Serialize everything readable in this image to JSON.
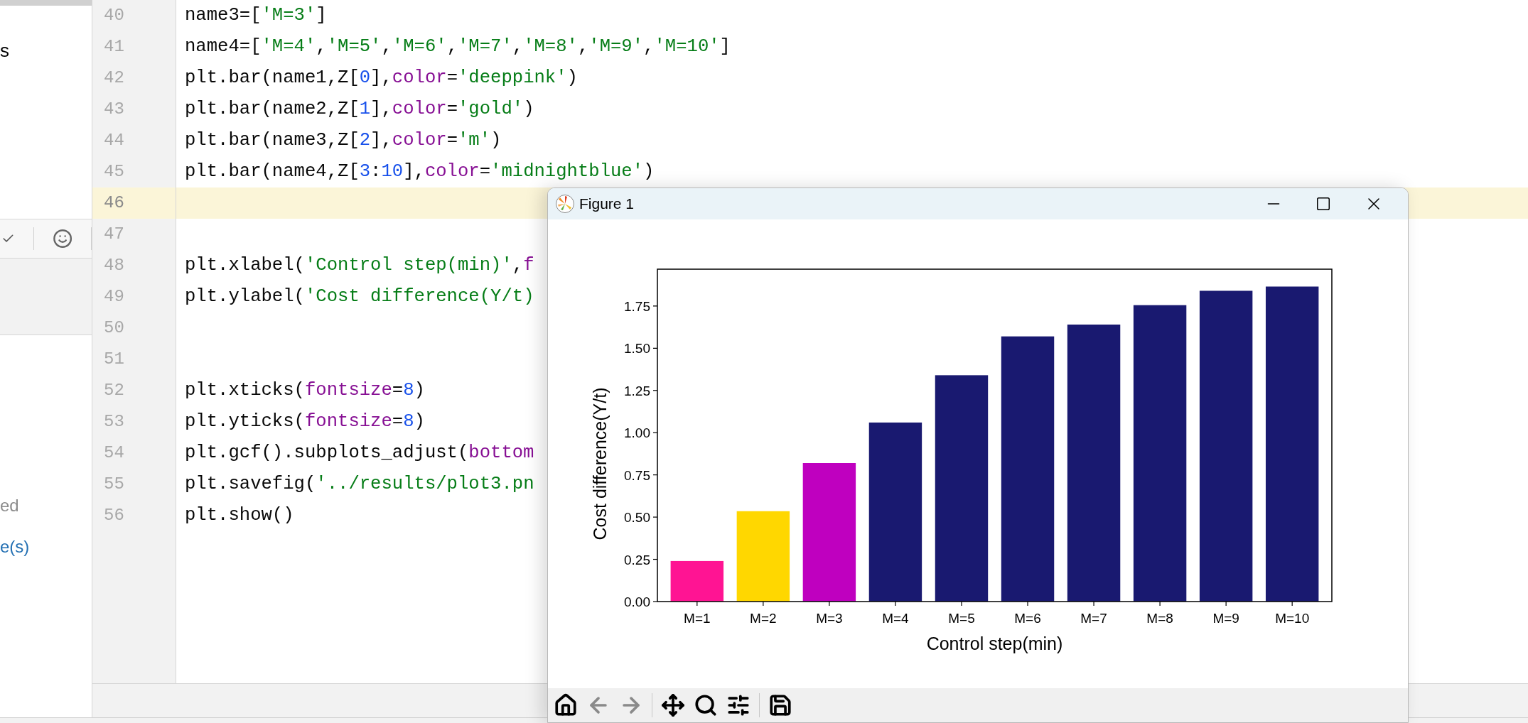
{
  "left_panel": {
    "fragment_1": "s",
    "status_text": "ed",
    "link_text": "e(s)"
  },
  "editor": {
    "lines": [
      {
        "number": "40",
        "current": false,
        "tokens": [
          {
            "kind": "code",
            "text": "name3=["
          },
          {
            "kind": "string",
            "text": "'M=3'"
          },
          {
            "kind": "code",
            "text": "]"
          }
        ]
      },
      {
        "number": "41",
        "current": false,
        "tokens": [
          {
            "kind": "code",
            "text": "name4=["
          },
          {
            "kind": "string",
            "text": "'M=4'"
          },
          {
            "kind": "code",
            "text": ","
          },
          {
            "kind": "string",
            "text": "'M=5'"
          },
          {
            "kind": "code",
            "text": ","
          },
          {
            "kind": "string",
            "text": "'M=6'"
          },
          {
            "kind": "code",
            "text": ","
          },
          {
            "kind": "string",
            "text": "'M=7'"
          },
          {
            "kind": "code",
            "text": ","
          },
          {
            "kind": "string",
            "text": "'M=8'"
          },
          {
            "kind": "code",
            "text": ","
          },
          {
            "kind": "string",
            "text": "'M=9'"
          },
          {
            "kind": "code",
            "text": ","
          },
          {
            "kind": "string",
            "text": "'M=10'"
          },
          {
            "kind": "code",
            "text": "]"
          }
        ]
      },
      {
        "number": "42",
        "current": false,
        "tokens": [
          {
            "kind": "code",
            "text": "plt.bar(name1,Z["
          },
          {
            "kind": "number",
            "text": "0"
          },
          {
            "kind": "code",
            "text": "],"
          },
          {
            "kind": "param",
            "text": "color"
          },
          {
            "kind": "code",
            "text": "="
          },
          {
            "kind": "string",
            "text": "'deeppink'"
          },
          {
            "kind": "code",
            "text": ")"
          }
        ]
      },
      {
        "number": "43",
        "current": false,
        "tokens": [
          {
            "kind": "code",
            "text": "plt.bar(name2,Z["
          },
          {
            "kind": "number",
            "text": "1"
          },
          {
            "kind": "code",
            "text": "],"
          },
          {
            "kind": "param",
            "text": "color"
          },
          {
            "kind": "code",
            "text": "="
          },
          {
            "kind": "string",
            "text": "'gold'"
          },
          {
            "kind": "code",
            "text": ")"
          }
        ]
      },
      {
        "number": "44",
        "current": false,
        "tokens": [
          {
            "kind": "code",
            "text": "plt.bar(name3,Z["
          },
          {
            "kind": "number",
            "text": "2"
          },
          {
            "kind": "code",
            "text": "],"
          },
          {
            "kind": "param",
            "text": "color"
          },
          {
            "kind": "code",
            "text": "="
          },
          {
            "kind": "string",
            "text": "'m'"
          },
          {
            "kind": "code",
            "text": ")"
          }
        ]
      },
      {
        "number": "45",
        "current": false,
        "tokens": [
          {
            "kind": "code",
            "text": "plt.bar(name4,Z["
          },
          {
            "kind": "number",
            "text": "3"
          },
          {
            "kind": "code",
            "text": ":"
          },
          {
            "kind": "number",
            "text": "10"
          },
          {
            "kind": "code",
            "text": "],"
          },
          {
            "kind": "param",
            "text": "color"
          },
          {
            "kind": "code",
            "text": "="
          },
          {
            "kind": "string",
            "text": "'midnightblue'"
          },
          {
            "kind": "code",
            "text": ")"
          }
        ]
      },
      {
        "number": "46",
        "current": true
      },
      {
        "number": "47",
        "current": false
      },
      {
        "number": "48",
        "current": false,
        "tokens": [
          {
            "kind": "code",
            "text": "plt.xlabel("
          },
          {
            "kind": "string",
            "text": "'Control step(min)'"
          },
          {
            "kind": "code",
            "text": ","
          },
          {
            "kind": "param",
            "text": "f"
          }
        ]
      },
      {
        "number": "49",
        "current": false,
        "tokens": [
          {
            "kind": "code",
            "text": "plt.ylabel("
          },
          {
            "kind": "string",
            "text": "'Cost difference(Y/t)"
          }
        ]
      },
      {
        "number": "50",
        "current": false
      },
      {
        "number": "51",
        "current": false
      },
      {
        "number": "52",
        "current": false,
        "tokens": [
          {
            "kind": "code",
            "text": "plt.xticks("
          },
          {
            "kind": "param",
            "text": "fontsize"
          },
          {
            "kind": "code",
            "text": "="
          },
          {
            "kind": "number",
            "text": "8"
          },
          {
            "kind": "code",
            "text": ")"
          }
        ]
      },
      {
        "number": "53",
        "current": false,
        "tokens": [
          {
            "kind": "code",
            "text": "plt.yticks("
          },
          {
            "kind": "param",
            "text": "fontsize"
          },
          {
            "kind": "code",
            "text": "="
          },
          {
            "kind": "number",
            "text": "8"
          },
          {
            "kind": "code",
            "text": ")"
          }
        ]
      },
      {
        "number": "54",
        "current": false,
        "tokens": [
          {
            "kind": "code",
            "text": "plt.gcf().subplots_adjust("
          },
          {
            "kind": "param",
            "text": "bottom"
          }
        ]
      },
      {
        "number": "55",
        "current": false,
        "tokens": [
          {
            "kind": "code",
            "text": "plt.savefig("
          },
          {
            "kind": "string",
            "text": "'../results/plot3.pn"
          }
        ]
      },
      {
        "number": "56",
        "current": false,
        "tokens": [
          {
            "kind": "code",
            "text": "plt.show()"
          }
        ]
      }
    ]
  },
  "figure_window": {
    "title": "Figure 1",
    "chart_data": {
      "type": "bar",
      "xlabel": "Control step(min)",
      "ylabel": "Cost difference(Y/t)",
      "categories": [
        "M=1",
        "M=2",
        "M=3",
        "M=4",
        "M=5",
        "M=6",
        "M=7",
        "M=8",
        "M=9",
        "M=10"
      ],
      "series": [
        {
          "color": "#ff1493",
          "values": [
            0.24,
            null,
            null,
            null,
            null,
            null,
            null,
            null,
            null,
            null
          ]
        },
        {
          "color": "#ffd700",
          "values": [
            null,
            0.535,
            null,
            null,
            null,
            null,
            null,
            null,
            null,
            null
          ]
        },
        {
          "color": "#bf00bf",
          "values": [
            null,
            null,
            0.82,
            null,
            null,
            null,
            null,
            null,
            null,
            null
          ]
        },
        {
          "color": "#191970",
          "values": [
            null,
            null,
            null,
            1.06,
            1.34,
            1.57,
            1.64,
            1.755,
            1.84,
            1.865
          ]
        }
      ],
      "ylim": [
        0,
        1.968
      ],
      "yticks": [
        {
          "value": 0,
          "label": "0.00"
        },
        {
          "value": 0.25,
          "label": "0.25"
        },
        {
          "value": 0.5,
          "label": "0.50"
        },
        {
          "value": 0.75,
          "label": "0.75"
        },
        {
          "value": 1,
          "label": "1.00"
        },
        {
          "value": 1.25,
          "label": "1.25"
        },
        {
          "value": 1.5,
          "label": "1.50"
        },
        {
          "value": 1.75,
          "label": "1.75"
        }
      ]
    },
    "toolbar": [
      {
        "kind": "home",
        "disabled": false
      },
      {
        "kind": "back",
        "disabled": true
      },
      {
        "kind": "forward",
        "disabled": true
      },
      {
        "kind": "pan",
        "disabled": false
      },
      {
        "kind": "zoom",
        "disabled": false
      },
      {
        "kind": "configure",
        "disabled": false
      },
      {
        "kind": "save",
        "disabled": false
      }
    ]
  }
}
